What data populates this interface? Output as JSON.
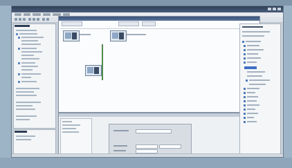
{
  "window": {
    "title": ""
  },
  "canvas": {
    "devices": [
      {
        "id": "device-1"
      },
      {
        "id": "device-2"
      },
      {
        "id": "device-3"
      }
    ]
  },
  "colors": {
    "background": "#9db3c6",
    "titlebar": "#2f3f57",
    "selection": "#3e6fc4",
    "network_line": "#4f8a4f"
  },
  "icons": [
    "toolbar-icons",
    "tree-icons",
    "plc-device-icon"
  ]
}
